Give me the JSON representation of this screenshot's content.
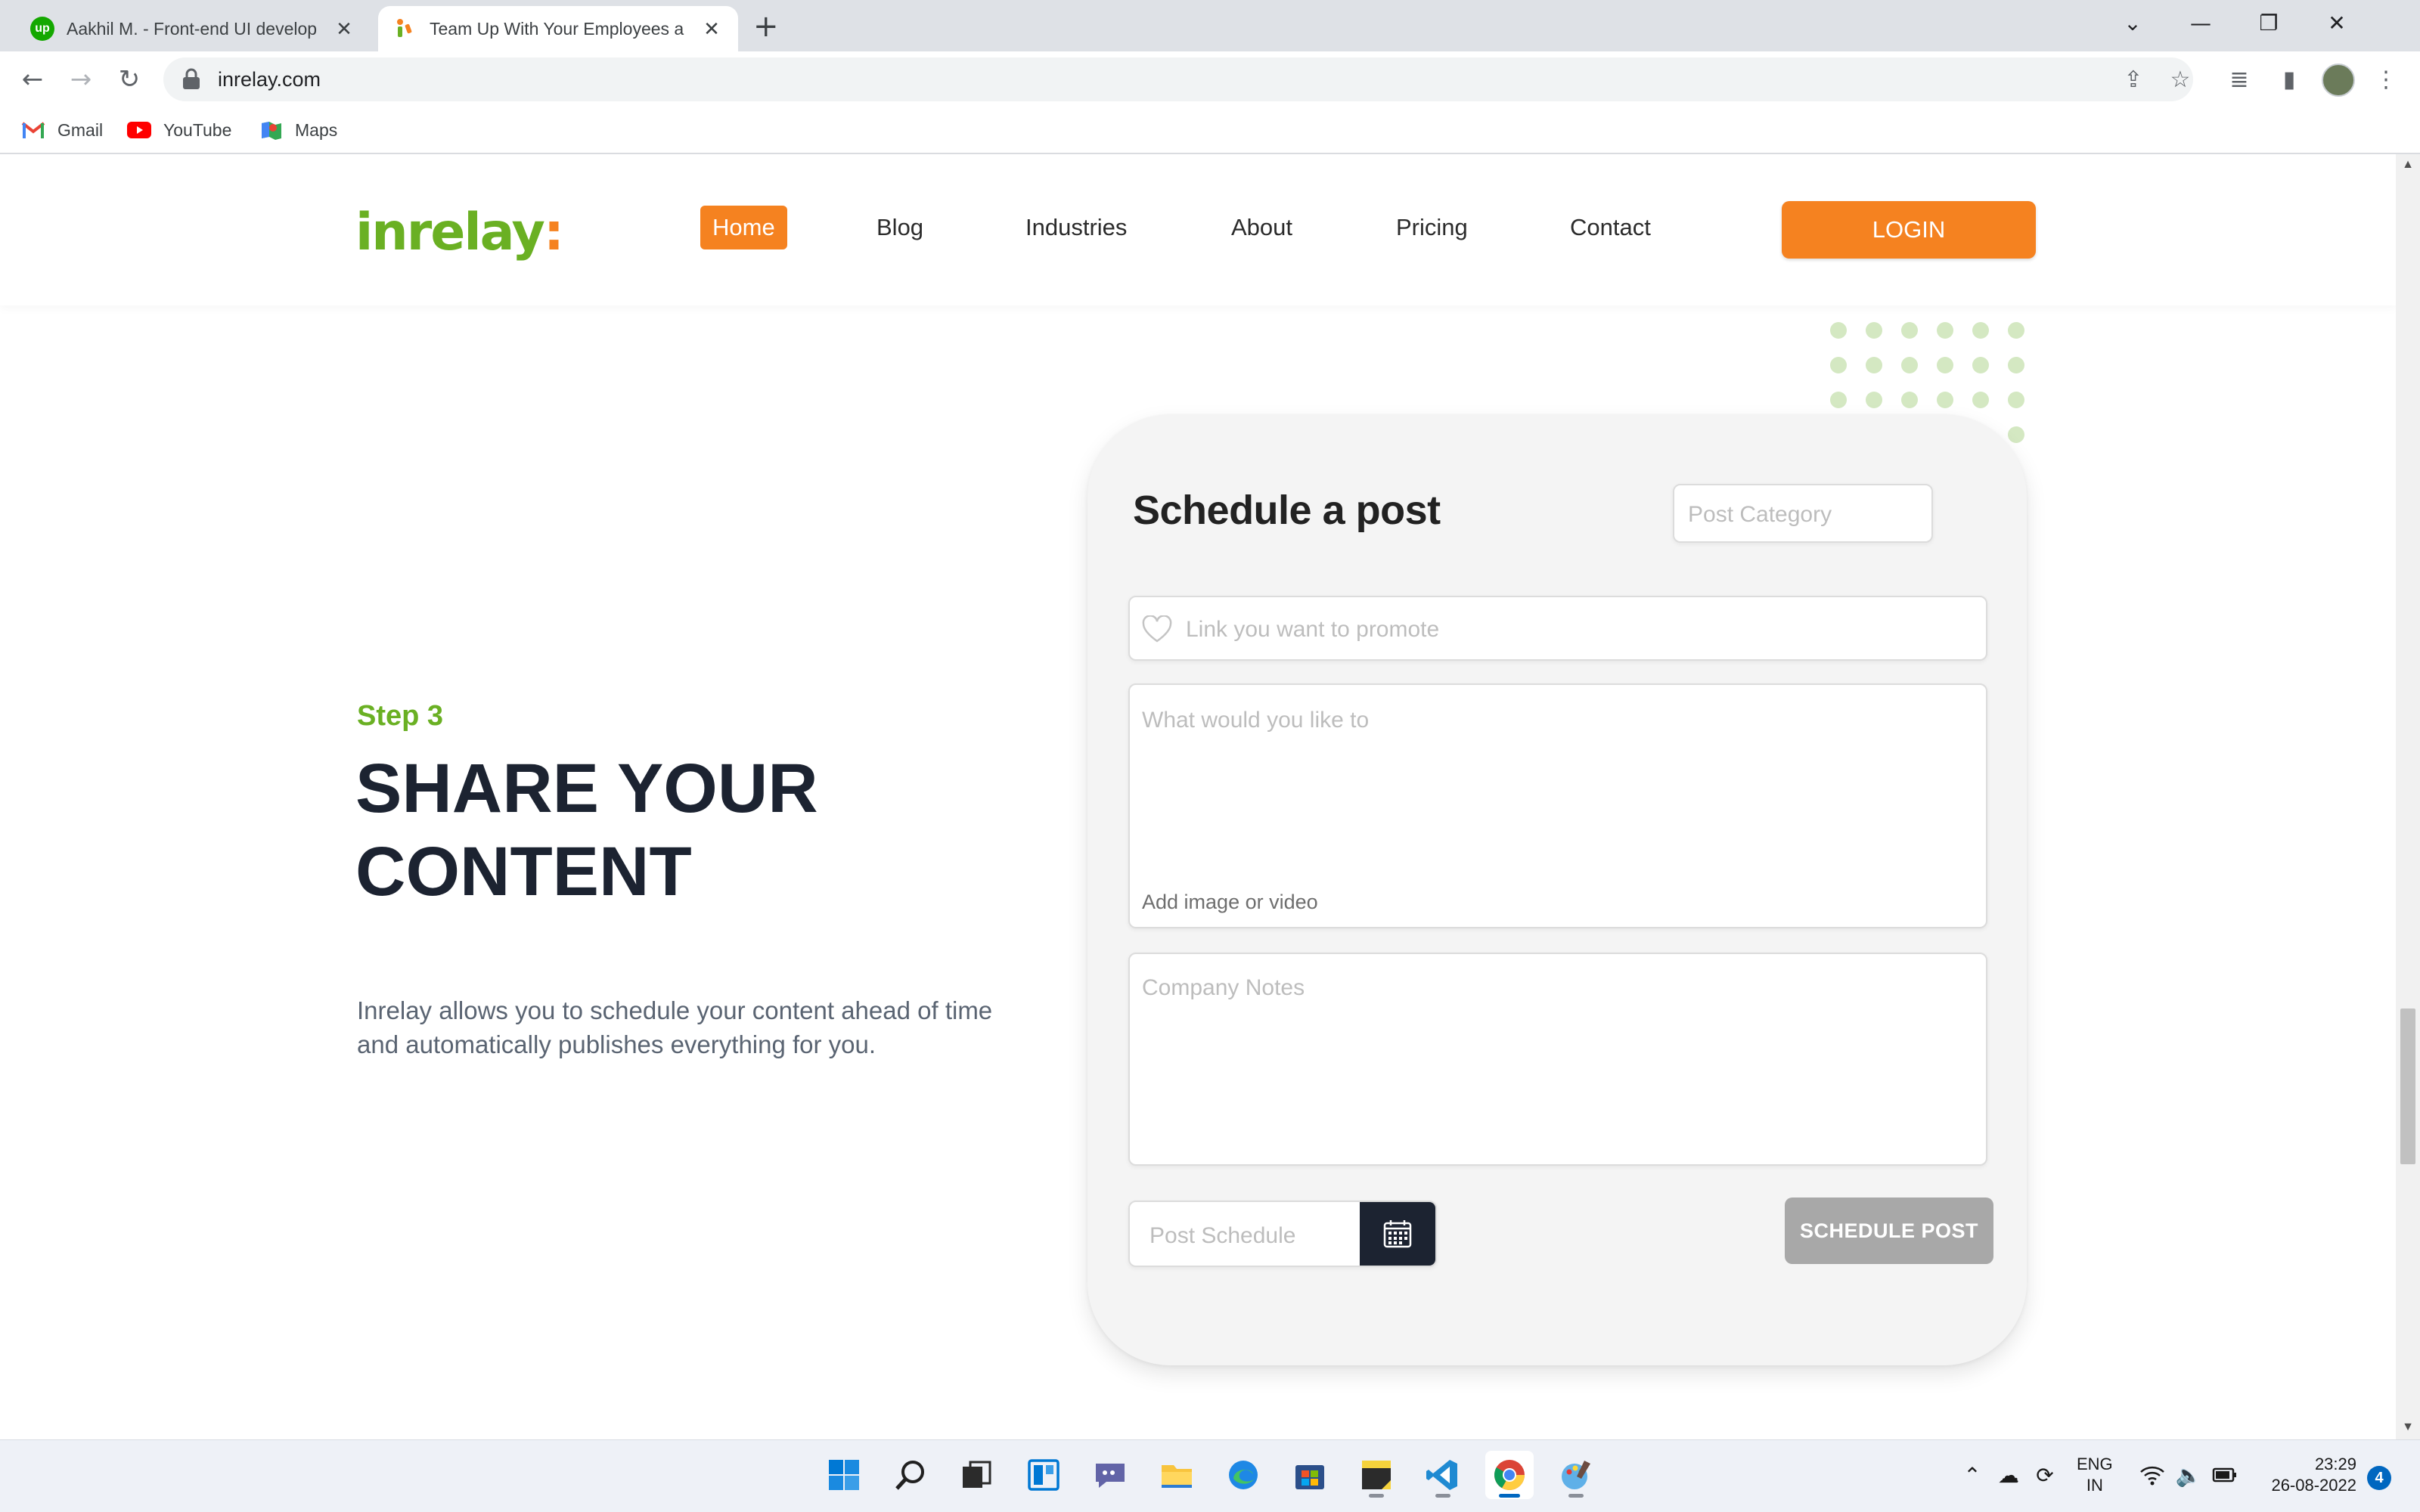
{
  "browser": {
    "tabs": [
      {
        "title": "Aakhil M. - Front-end UI develop",
        "close": "✕"
      },
      {
        "title": "Team Up With Your Employees a",
        "close": "✕"
      }
    ],
    "new_tab": "+",
    "window_controls": {
      "list": "⌄",
      "minimize": "—",
      "restore": "❐",
      "close": "✕"
    },
    "url": "inrelay.com",
    "bookmarks": [
      {
        "label": "Gmail",
        "icon": "gmail-icon"
      },
      {
        "label": "YouTube",
        "icon": "youtube-icon"
      },
      {
        "label": "Maps",
        "icon": "maps-icon"
      }
    ]
  },
  "site": {
    "logo": {
      "text": "inrelay",
      "suffix": ":"
    },
    "nav": [
      "Home",
      "Blog",
      "Industries",
      "About",
      "Pricing",
      "Contact"
    ],
    "active_nav": "Home",
    "login": "LOGIN"
  },
  "section": {
    "step": "Step 3",
    "headline_line1": "SHARE YOUR",
    "headline_line2": "CONTENT",
    "description": "Inrelay allows you to schedule your content ahead of time and automatically publishes everything for you."
  },
  "form": {
    "title": "Schedule a post",
    "category_placeholder": "Post Category",
    "link_placeholder": "Link you want to promote",
    "content_placeholder": "What would you like to",
    "add_media": "Add image or video",
    "notes_placeholder": "Company Notes",
    "schedule_placeholder": "Post Schedule",
    "submit": "SCHEDULE POST"
  },
  "taskbar": {
    "apps": [
      "windows-start-icon",
      "search-icon",
      "task-view-icon",
      "widgets-icon",
      "chat-icon",
      "file-explorer-icon",
      "edge-icon",
      "store-icon",
      "sticky-notes-icon",
      "vscode-icon",
      "chrome-icon",
      "paint-icon"
    ],
    "language": {
      "line1": "ENG",
      "line2": "IN"
    },
    "time": "23:29",
    "date": "26-08-2022",
    "notifications": "4"
  },
  "colors": {
    "brand_green": "#6ab023",
    "brand_orange": "#f58220",
    "heading_dark": "#1c2331",
    "submit_disabled": "#a8a8a8"
  }
}
